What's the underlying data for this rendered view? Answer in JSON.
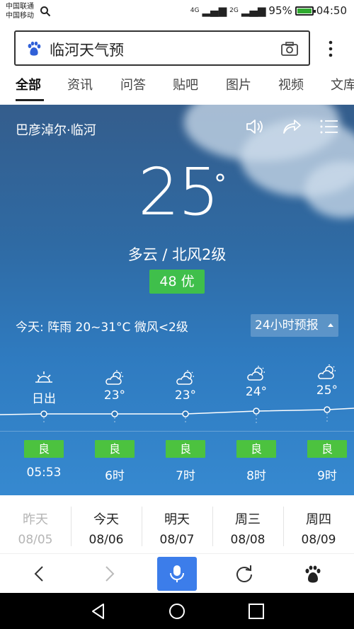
{
  "status_bar": {
    "carrier1": "中国联通",
    "carrier2": "中国移动",
    "signal1": "4G",
    "signal2": "2G",
    "battery": "95%",
    "time": "04:50"
  },
  "search": {
    "query": "临河天气预"
  },
  "tabs": [
    {
      "label": "全部",
      "active": true
    },
    {
      "label": "资讯"
    },
    {
      "label": "问答"
    },
    {
      "label": "贴吧"
    },
    {
      "label": "图片"
    },
    {
      "label": "视频"
    },
    {
      "label": "文库"
    }
  ],
  "weather": {
    "location": "巴彦淖尔·临河",
    "temperature": "25",
    "degree_symbol": "°",
    "condition": "多云  /  北风2级",
    "aqi": "48 优",
    "today_summary": "今天:  阵雨  20~31°C  微风<2级",
    "forecast_button": "24小时预报"
  },
  "hourly": [
    {
      "top": "日出",
      "icon": "sunrise-icon",
      "quality": "良",
      "time": "05:53"
    },
    {
      "top": "23°",
      "icon": "partly-cloudy-icon",
      "quality": "良",
      "time": "6时"
    },
    {
      "top": "23°",
      "icon": "partly-cloudy-icon",
      "quality": "良",
      "time": "7时"
    },
    {
      "top": "24°",
      "icon": "partly-cloudy-icon",
      "quality": "良",
      "time": "8时"
    },
    {
      "top": "25°",
      "icon": "partly-cloudy-icon",
      "quality": "良",
      "time": "9时"
    }
  ],
  "days": [
    {
      "name": "昨天",
      "date": "08/05",
      "past": true
    },
    {
      "name": "今天",
      "date": "08/06"
    },
    {
      "name": "明天",
      "date": "08/07"
    },
    {
      "name": "周三",
      "date": "08/08"
    },
    {
      "name": "周四",
      "date": "08/09"
    }
  ],
  "colors": {
    "accent_blue": "#3c7dea",
    "aqi_green": "#3fbf4b",
    "quality_green": "#4cc23f"
  }
}
